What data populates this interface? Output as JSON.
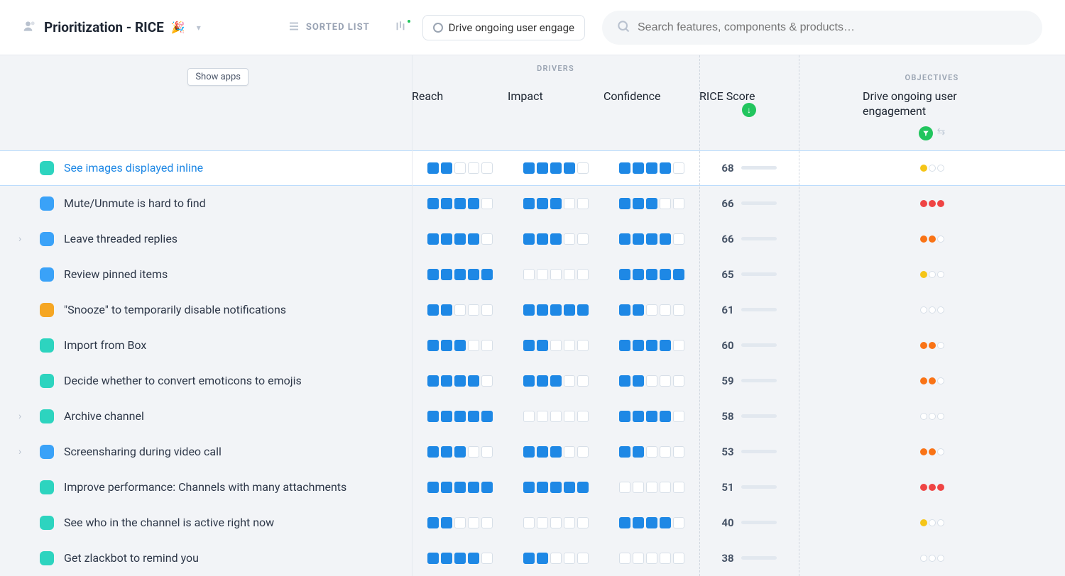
{
  "header": {
    "title": "Prioritization - RICE",
    "emoji": "🎉",
    "view_mode": "SORTED LIST",
    "objective_pill": "Drive ongoing user engage",
    "search_placeholder": "Search features, components & products…"
  },
  "columns": {
    "drivers_label": "DRIVERS",
    "objectives_label": "OBJECTIVES",
    "reach": "Reach",
    "impact": "Impact",
    "confidence": "Confidence",
    "rice_score": "RICE Score",
    "objective": "Drive ongoing user engagement"
  },
  "tooltip": {
    "show_apps": "Show apps"
  },
  "colors": {
    "teal": "#2dd4bf",
    "blue_accent": "#3aa2f8",
    "amber": "#f5a623",
    "yellow": "#f5c518",
    "red": "#ef4444",
    "orange": "#f97316",
    "block_fill": "#1e88e5"
  },
  "rows": [
    {
      "name": "See images displayed inline",
      "swatch": "teal",
      "selected": true,
      "expand": false,
      "reach": 2,
      "impact": 4,
      "confidence": 4,
      "score": 68,
      "objective_dots": [
        "yellow",
        null,
        null
      ]
    },
    {
      "name": "Mute/Unmute is hard to find",
      "swatch": "blue",
      "selected": false,
      "expand": false,
      "reach": 4,
      "impact": 3,
      "confidence": 3,
      "score": 66,
      "objective_dots": [
        "red",
        "red",
        "red"
      ]
    },
    {
      "name": "Leave threaded replies",
      "swatch": "blue",
      "selected": false,
      "expand": true,
      "reach": 4,
      "impact": 3,
      "confidence": 4,
      "score": 66,
      "objective_dots": [
        "orange",
        "orange",
        null
      ]
    },
    {
      "name": "Review pinned items",
      "swatch": "blue",
      "selected": false,
      "expand": false,
      "reach": 5,
      "impact": 0,
      "confidence": 5,
      "score": 65,
      "objective_dots": [
        "yellow",
        null,
        null
      ]
    },
    {
      "name": "\"Snooze\" to temporarily disable notifications",
      "swatch": "amber",
      "selected": false,
      "expand": false,
      "reach": 2,
      "impact": 5,
      "confidence": 2,
      "score": 61,
      "objective_dots": [
        null,
        null,
        null
      ]
    },
    {
      "name": "Import from Box",
      "swatch": "teal",
      "selected": false,
      "expand": false,
      "reach": 3,
      "impact": 2,
      "confidence": 4,
      "score": 60,
      "objective_dots": [
        "orange",
        "orange",
        null
      ]
    },
    {
      "name": "Decide whether to convert emoticons to emojis",
      "swatch": "teal",
      "selected": false,
      "expand": false,
      "reach": 4,
      "impact": 3,
      "confidence": 2,
      "score": 59,
      "objective_dots": [
        "orange",
        "orange",
        null
      ]
    },
    {
      "name": "Archive channel",
      "swatch": "teal",
      "selected": false,
      "expand": true,
      "reach": 5,
      "impact": 0,
      "confidence": 4,
      "score": 58,
      "objective_dots": [
        null,
        null,
        null
      ]
    },
    {
      "name": "Screensharing during video call",
      "swatch": "blue",
      "selected": false,
      "expand": true,
      "reach": 3,
      "impact": 3,
      "confidence": 2,
      "score": 53,
      "objective_dots": [
        "orange",
        "orange",
        null
      ]
    },
    {
      "name": "Improve performance: Channels with many attachments",
      "swatch": "teal",
      "selected": false,
      "expand": false,
      "reach": 5,
      "impact": 5,
      "confidence": 0,
      "score": 51,
      "objective_dots": [
        "red",
        "red",
        "red"
      ]
    },
    {
      "name": "See who in the channel is active right now",
      "swatch": "teal",
      "selected": false,
      "expand": false,
      "reach": 2,
      "impact": 0,
      "confidence": 4,
      "score": 40,
      "objective_dots": [
        "yellow",
        null,
        null
      ]
    },
    {
      "name": "Get zlackbot to remind you",
      "swatch": "teal",
      "selected": false,
      "expand": false,
      "reach": 4,
      "impact": 2,
      "confidence": 0,
      "score": 38,
      "objective_dots": [
        null,
        null,
        null
      ]
    }
  ]
}
